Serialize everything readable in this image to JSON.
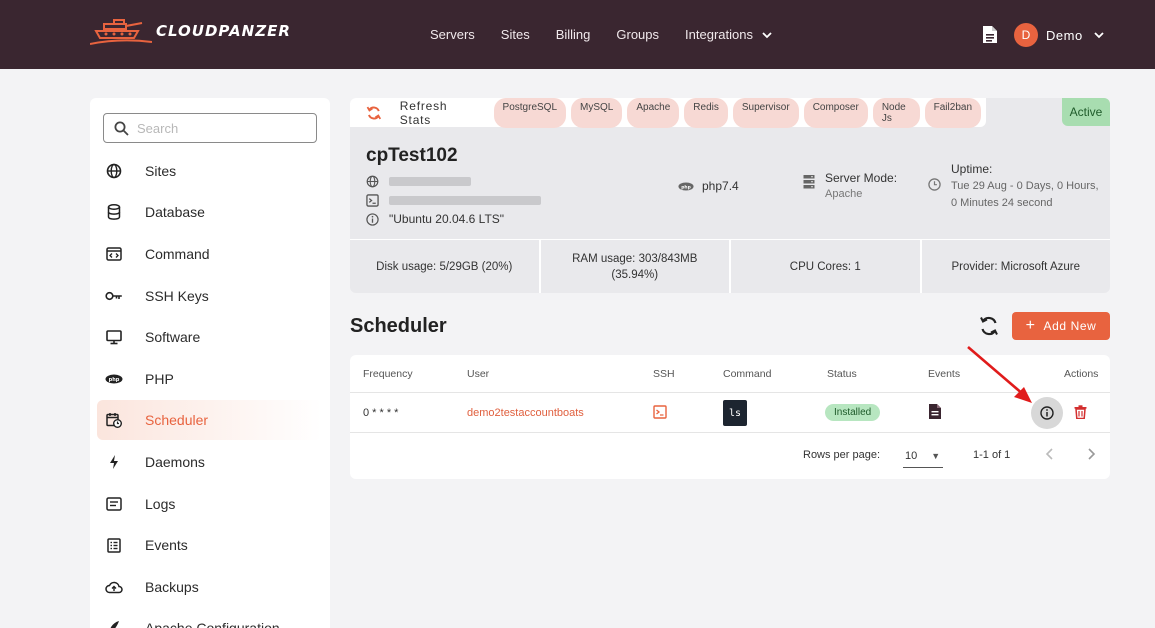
{
  "brand": {
    "name": "CLOUDPANZER"
  },
  "nav": {
    "items": [
      "Servers",
      "Sites",
      "Billing",
      "Groups",
      "Integrations"
    ],
    "user_initial": "D",
    "user_name": "Demo"
  },
  "sidebar": {
    "search_placeholder": "Search",
    "items": [
      {
        "label": "Sites",
        "icon": "globe-icon"
      },
      {
        "label": "Database",
        "icon": "database-icon"
      },
      {
        "label": "Command",
        "icon": "code-window-icon"
      },
      {
        "label": "SSH Keys",
        "icon": "key-icon"
      },
      {
        "label": "Software",
        "icon": "monitor-icon"
      },
      {
        "label": "PHP",
        "icon": "php-icon"
      },
      {
        "label": "Scheduler",
        "icon": "calendar-clock-icon",
        "active": true
      },
      {
        "label": "Daemons",
        "icon": "bolt-icon"
      },
      {
        "label": "Logs",
        "icon": "log-icon"
      },
      {
        "label": "Events",
        "icon": "list-icon"
      },
      {
        "label": "Backups",
        "icon": "cloud-upload-icon"
      },
      {
        "label": "Apache Configuration",
        "icon": "feather-icon"
      }
    ]
  },
  "server": {
    "refresh_label": "Refresh Stats",
    "chips": [
      "PostgreSQL",
      "MySQL",
      "Apache",
      "Redis",
      "Supervisor",
      "Composer",
      "Node Js",
      "Fail2ban"
    ],
    "status": "Active",
    "name": "cpTest102",
    "os": "\"Ubuntu 20.04.6 LTS\"",
    "php": "php7.4",
    "mode_label": "Server Mode:",
    "mode_value": "Apache",
    "uptime_label": "Uptime:",
    "uptime_value": "Tue 29 Aug - 0 Days, 0 Hours, 0 Minutes 24 second",
    "stats": [
      {
        "label": "Disk usage:",
        "value": "5/29GB (20%)"
      },
      {
        "label": "RAM usage:",
        "value": "303/843MB (35.94%)"
      },
      {
        "label": "CPU Cores:",
        "value": "1"
      },
      {
        "label": "Provider:",
        "value": "Microsoft Azure"
      }
    ]
  },
  "scheduler": {
    "title": "Scheduler",
    "add_label": "Add New",
    "columns": [
      "Frequency",
      "User",
      "SSH",
      "Command",
      "Status",
      "Events",
      "Actions"
    ],
    "rows": [
      {
        "frequency": "0 * * * *",
        "user": "demo2testaccountboats",
        "command": "ls",
        "status": "Installed"
      }
    ],
    "rows_per_page_label": "Rows per page:",
    "rows_per_page": "10",
    "range": "1-1 of 1"
  }
}
